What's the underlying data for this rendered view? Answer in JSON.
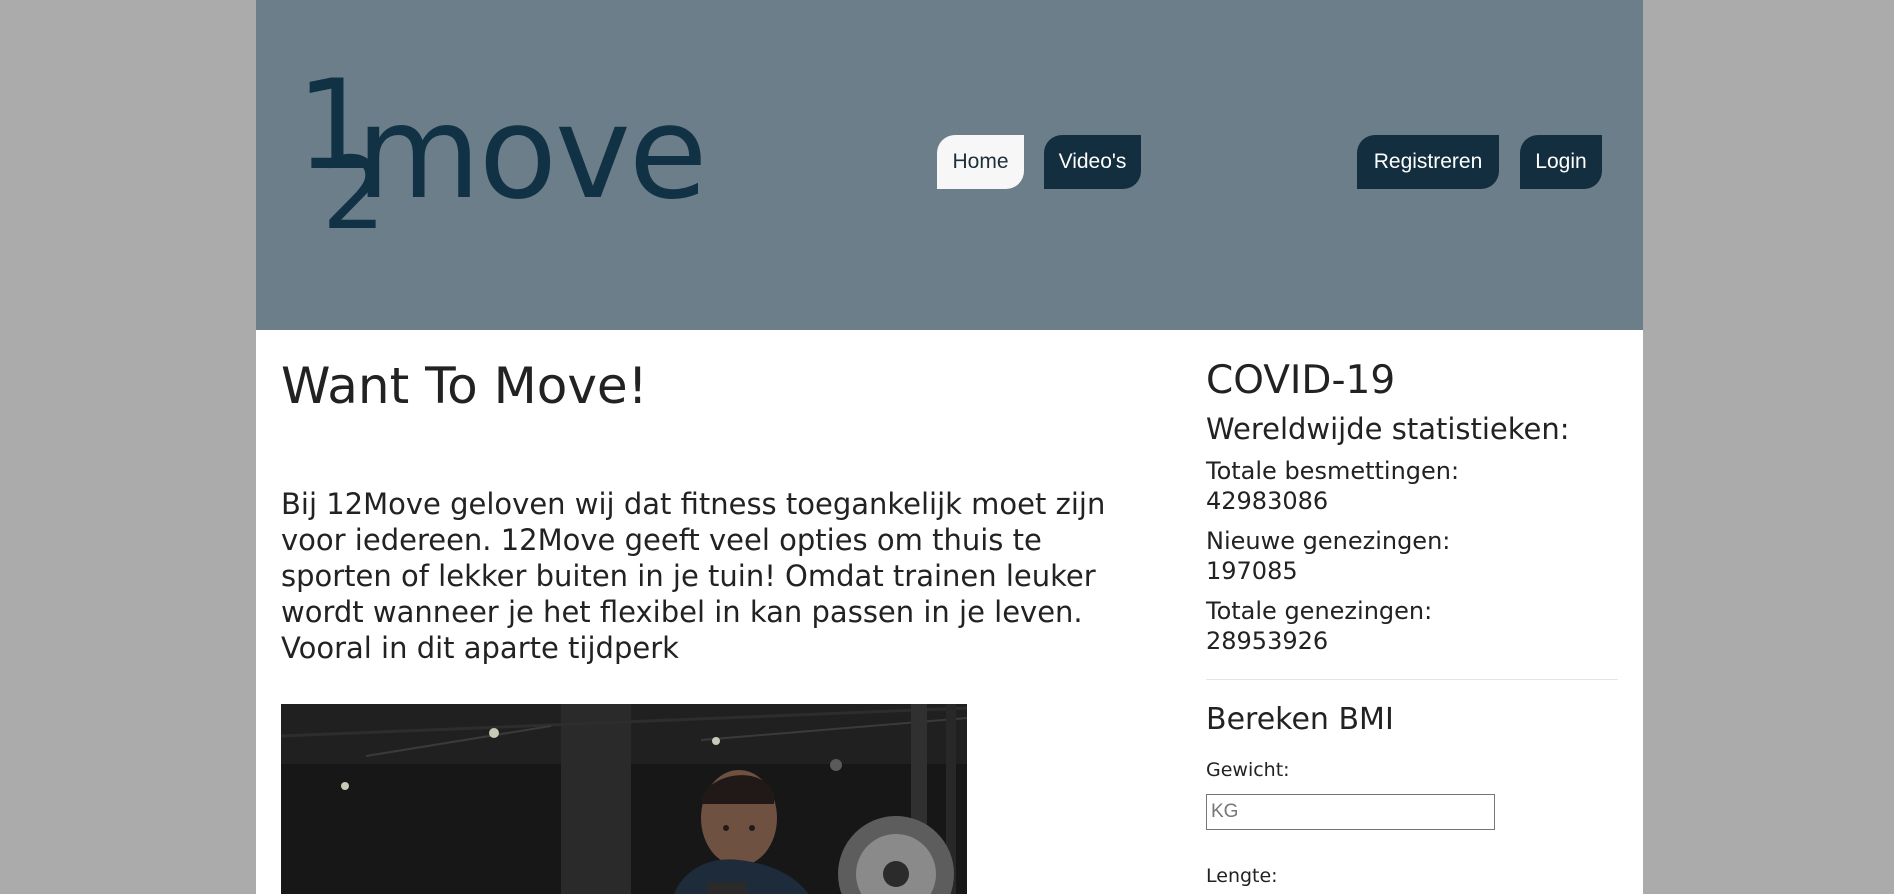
{
  "header": {
    "logo": {
      "text": "12move"
    },
    "nav": {
      "home": "Home",
      "videos": "Video's",
      "register": "Registreren",
      "login": "Login"
    }
  },
  "main": {
    "title": "Want To Move!",
    "intro": "Bij 12Move geloven wij dat fitness toegankelijk moet zijn voor iedereen. 12Move geeft veel opties om thuis te sporten of lekker buiten in je tuin! Omdat trainen leuker wordt wanneer je het flexibel in kan passen in je leven. Vooral in dit aparte tijdperk"
  },
  "sidebar": {
    "covid": {
      "title": "COVID-19",
      "subtitle": "Wereldwijde statistieken:",
      "stats": [
        {
          "label": "Totale besmettingen:",
          "value": "42983086"
        },
        {
          "label": "Nieuwe genezingen:",
          "value": "197085"
        },
        {
          "label": "Totale genezingen:",
          "value": "28953926"
        }
      ]
    },
    "bmi": {
      "title": "Bereken BMI",
      "weight_label": "Gewicht:",
      "weight_placeholder": "KG",
      "length_label": "Lengte:"
    }
  },
  "colors": {
    "page_background": "#ababab",
    "header_background": "#6b7e8a",
    "button_background": "#132e3f",
    "active_button_background": "#f7f7f7",
    "logo_color": "#113245"
  }
}
